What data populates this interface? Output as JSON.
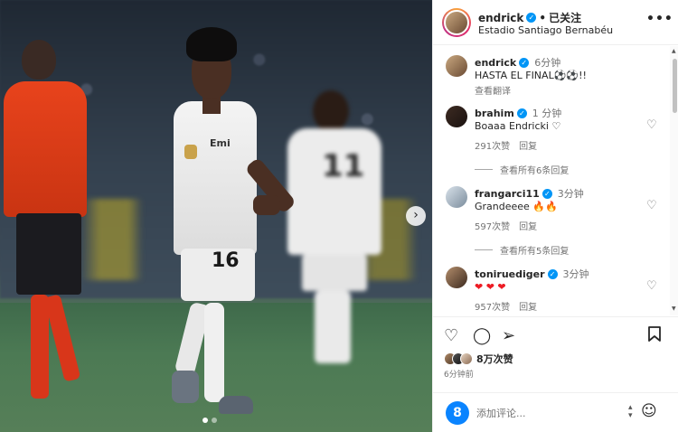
{
  "post": {
    "author": "endrick",
    "follow_status": "已关注",
    "location": "Estadio Santiago Bernabéu",
    "more": "•••",
    "jersey_numbers": {
      "main": "16",
      "background": "11"
    },
    "carousel": {
      "pages": 2,
      "current": 1
    }
  },
  "caption": {
    "username": "endrick",
    "time": "6分钟",
    "text": "HASTA EL FINAL⚽⚽!!",
    "translate": "查看翻译"
  },
  "comments": [
    {
      "username": "brahim",
      "time": "1 分钟",
      "text": "Boaaa Endricki ♡",
      "likes": "291次赞",
      "reply": "回复",
      "view_replies": "查看所有6条回复"
    },
    {
      "username": "frangarci11",
      "time": "3分钟",
      "text": "Grandeeee 🔥🔥",
      "likes": "597次赞",
      "reply": "回复",
      "view_replies": "查看所有5条回复"
    },
    {
      "username": "toniruediger",
      "time": "3分钟",
      "text": "❤ ❤ ❤",
      "likes": "957次赞",
      "reply": "回复"
    }
  ],
  "actions": {
    "likes_count": "8万次赞",
    "post_time": "6分钟前"
  },
  "composer": {
    "placeholder": "添加评论..."
  },
  "icons": {
    "like": "heart-icon",
    "comment": "comment-icon",
    "share": "share-icon",
    "save": "bookmark-icon",
    "emoji": "emoji-icon"
  },
  "colors": {
    "verified": "#0095f6",
    "meta_text": "#737373",
    "border": "#efefef"
  }
}
